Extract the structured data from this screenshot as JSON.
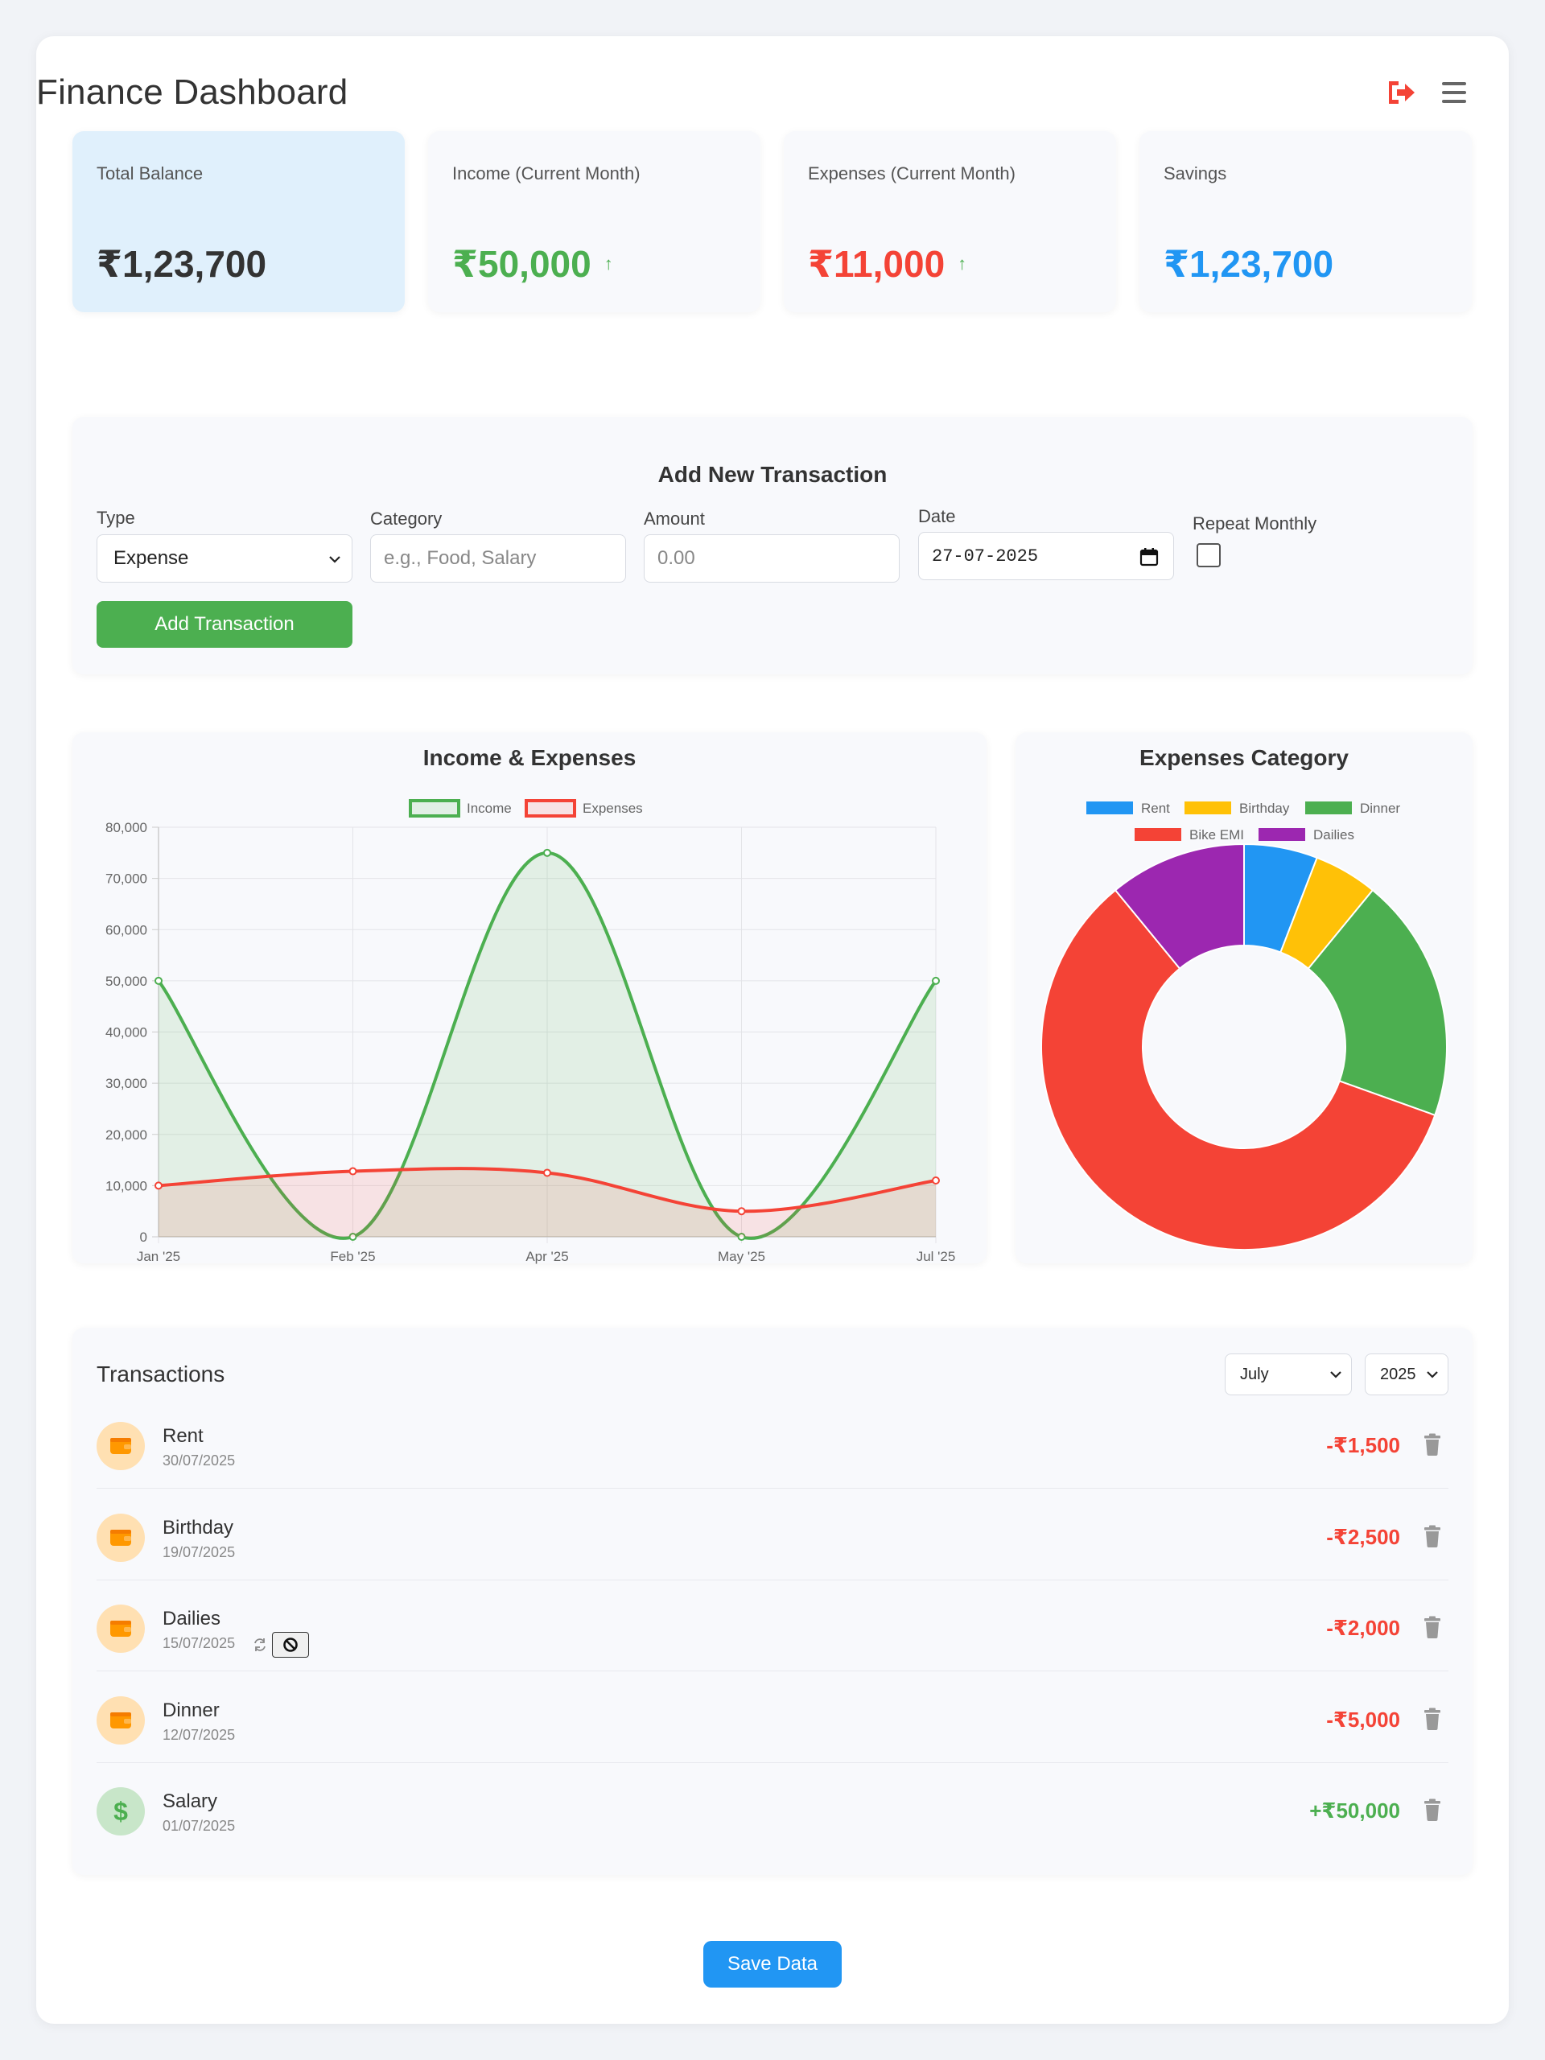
{
  "header": {
    "title": "Finance Dashboard",
    "logout_icon": "logout-icon",
    "menu_icon": "hamburger-menu-icon"
  },
  "cards": [
    {
      "label": "Total Balance",
      "value": "₹1,23,700",
      "color": "#333333"
    },
    {
      "label": "Income (Current Month)",
      "value": "₹50,000",
      "color": "#4caf50",
      "arrow": "↑"
    },
    {
      "label": "Expenses (Current Month)",
      "value": "₹11,000",
      "color": "#f44336",
      "arrow": "↑"
    },
    {
      "label": "Savings",
      "value": "₹1,23,700",
      "color": "#2196f3"
    }
  ],
  "form": {
    "title": "Add New Transaction",
    "type_label": "Type",
    "type_value": "Expense",
    "category_label": "Category",
    "category_placeholder": "e.g., Food, Salary",
    "amount_label": "Amount",
    "amount_placeholder": "0.00",
    "date_label": "Date",
    "date_value": "27-07-2025",
    "repeat_label": "Repeat Monthly",
    "submit_label": "Add Transaction"
  },
  "line_chart_title": "Income & Expenses",
  "pie_chart_title": "Expenses Category",
  "chart_data": [
    {
      "type": "line",
      "title": "Income & Expenses",
      "x": [
        "Jan '25",
        "Feb '25",
        "Apr '25",
        "May '25",
        "Jul '25"
      ],
      "series": [
        {
          "name": "Income",
          "values": [
            50000,
            0,
            75000,
            0,
            50000
          ],
          "color": "#4caf50"
        },
        {
          "name": "Expenses",
          "values": [
            10000,
            12800,
            12500,
            5000,
            11000
          ],
          "color": "#f44336"
        }
      ],
      "ylim": [
        0,
        80000
      ],
      "yticks": [
        "0",
        "10,000",
        "20,000",
        "30,000",
        "40,000",
        "50,000",
        "60,000",
        "70,000",
        "80,000"
      ],
      "legend": "top",
      "grid": true
    },
    {
      "type": "pie",
      "title": "Expenses Category",
      "categories": [
        "Rent",
        "Birthday",
        "Dinner",
        "Bike EMI",
        "Dailies"
      ],
      "values": [
        1500,
        1300,
        5000,
        15000,
        2800
      ],
      "colors": [
        "#2196f3",
        "#ffc107",
        "#4caf50",
        "#f44336",
        "#9c27b0"
      ],
      "legend": "top"
    }
  ],
  "transactions": {
    "title": "Transactions",
    "month_value": "July",
    "year_value": "2025",
    "items": [
      {
        "name": "Rent",
        "date": "30/07/2025",
        "amount": "-₹1,500",
        "kind": "expense",
        "icon": "wallet-icon"
      },
      {
        "name": "Birthday",
        "date": "19/07/2025",
        "amount": "-₹2,500",
        "kind": "expense",
        "icon": "wallet-icon"
      },
      {
        "name": "Dailies",
        "date": "15/07/2025",
        "amount": "-₹2,000",
        "kind": "expense",
        "icon": "wallet-icon",
        "recurring": true
      },
      {
        "name": "Dinner",
        "date": "12/07/2025",
        "amount": "-₹5,000",
        "kind": "expense",
        "icon": "wallet-icon"
      },
      {
        "name": "Salary",
        "date": "01/07/2025",
        "amount": "+₹50,000",
        "kind": "income",
        "icon": "dollar-icon"
      }
    ]
  },
  "save_label": "Save Data",
  "colors": {
    "income": "#4caf50",
    "expense": "#f44336",
    "accent": "#2196f3",
    "expense_avatar_bg": "#ffe0b2",
    "income_avatar_bg": "#c8e6c9"
  }
}
